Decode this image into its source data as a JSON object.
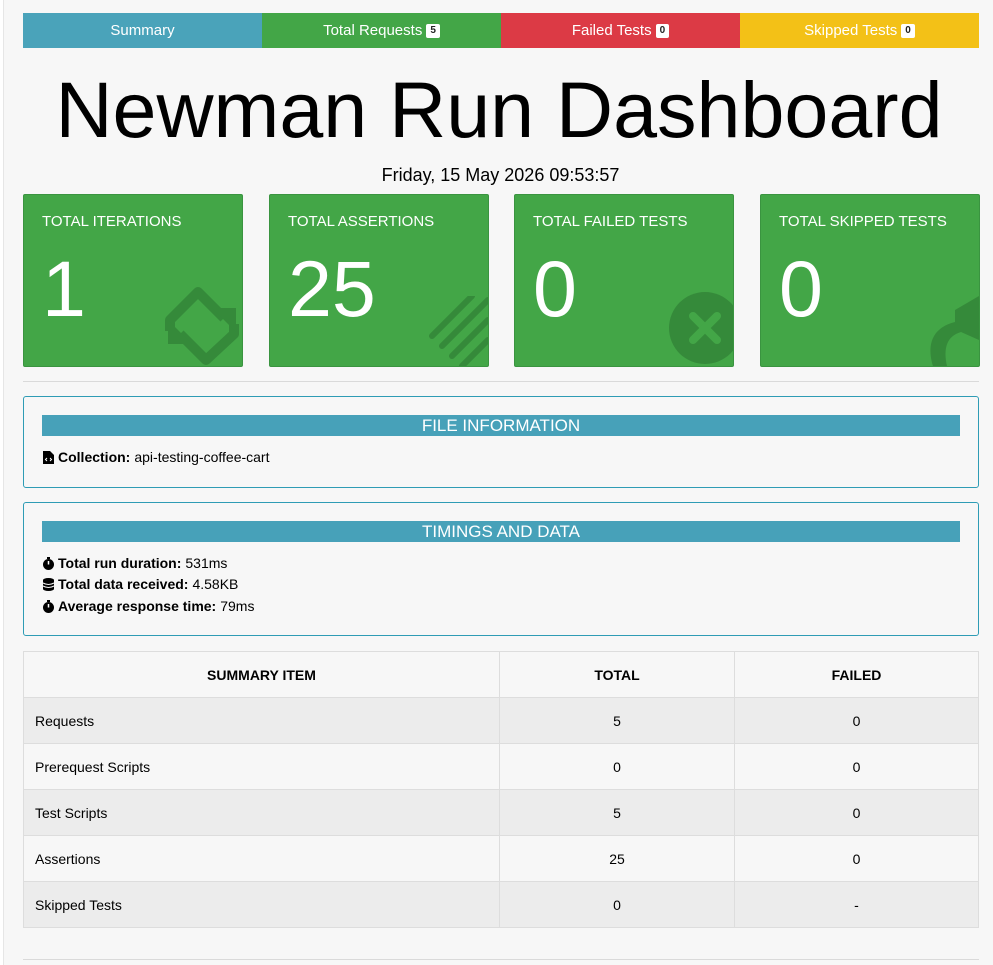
{
  "tabs": [
    {
      "label": "Summary",
      "badge": "",
      "color": "#4aa3ba"
    },
    {
      "label": "Total Requests",
      "badge": "5",
      "color": "#43a647"
    },
    {
      "label": "Failed Tests",
      "badge": "0",
      "color": "#dc3a45"
    },
    {
      "label": "Skipped Tests",
      "badge": "0",
      "color": "#f3c117"
    }
  ],
  "title": "Newman Run Dashboard",
  "date": "Friday, 15 May 2026 09:53:57",
  "cards": [
    {
      "label": "TOTAL ITERATIONS",
      "value": "1",
      "icon": "sync-icon"
    },
    {
      "label": "TOTAL ASSERTIONS",
      "value": "25",
      "icon": "ruler-icon"
    },
    {
      "label": "TOTAL FAILED TESTS",
      "value": "0",
      "icon": "times-circle-icon"
    },
    {
      "label": "TOTAL SKIPPED TESTS",
      "value": "0",
      "icon": "share-arrow-icon"
    }
  ],
  "file_info": {
    "heading": "FILE INFORMATION",
    "collection_label": "Collection:",
    "collection_value": "api-testing-coffee-cart"
  },
  "timings": {
    "heading": "TIMINGS AND DATA",
    "duration_label": "Total run duration:",
    "duration_value": "531ms",
    "data_label": "Total data received:",
    "data_value": "4.58KB",
    "avg_label": "Average response time:",
    "avg_value": "79ms"
  },
  "summary_table": {
    "headers": [
      "SUMMARY ITEM",
      "TOTAL",
      "FAILED"
    ],
    "rows": [
      [
        "Requests",
        "5",
        "0"
      ],
      [
        "Prerequest Scripts",
        "0",
        "0"
      ],
      [
        "Test Scripts",
        "5",
        "0"
      ],
      [
        "Assertions",
        "25",
        "0"
      ],
      [
        "Skipped Tests",
        "0",
        "-"
      ]
    ]
  },
  "colors": {
    "card_green": "#43a647",
    "panel_teal": "#47a1b9"
  }
}
